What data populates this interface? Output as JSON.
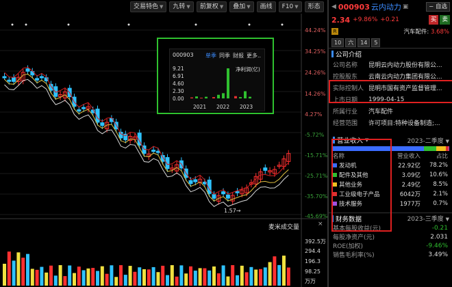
{
  "toolbar": {
    "items": [
      "交易特色",
      "九转",
      "前复权",
      "叠加",
      "画线",
      "F10",
      "形态"
    ]
  },
  "yaxis": {
    "price_labels": [
      "44.24%",
      "34.25%",
      "24.26%",
      "14.26%",
      "4.27%",
      "-5.72%",
      "-15.71%",
      "-25.71%",
      "-35.70%",
      "-45.69%"
    ],
    "volume_labels": [
      "392.5万",
      "294.4",
      "196.3",
      "98.25",
      "万万"
    ]
  },
  "chart": {
    "low_label": "1.57",
    "volume_title": "麦米成交量",
    "close_btn": "×"
  },
  "popup": {
    "code": "000903",
    "tabs": [
      "单季",
      "同季",
      "财报",
      "更多.."
    ],
    "title": "净利润(亿)",
    "yticks": [
      "9.21",
      "6.91",
      "4.60",
      "2.30",
      "0.00"
    ],
    "years": [
      "2021",
      "2022",
      "2023"
    ],
    "bars": [
      0.3,
      0.6,
      0.2,
      0.5,
      0.4,
      1.1,
      1.6,
      9.21,
      0.7,
      0.4,
      2.2,
      0.5
    ]
  },
  "header": {
    "code": "000903",
    "name": "云内动力",
    "add_label": "自选",
    "price": "2.34",
    "pct": "+9.86%",
    "change": "+0.21",
    "buy": "买",
    "sell": "卖",
    "badge": "R",
    "sector_label": "汽车配件:",
    "sector_pct": "3.68%",
    "num_tabs": [
      "10",
      "六",
      "14",
      "5"
    ]
  },
  "company": {
    "title": "公司介绍",
    "rows": [
      {
        "k": "公司名称",
        "v": "昆明云内动力股份有限公..."
      },
      {
        "k": "控股股东",
        "v": "云南云内动力集团有限公..."
      },
      {
        "k": "实际控制人",
        "v": "昆明市国有资产监督管理..."
      },
      {
        "k": "上市日期",
        "v": "1999-04-15"
      },
      {
        "k": "所属行业",
        "v": "汽车配件"
      },
      {
        "k": "经营范围",
        "v": "许可项目:特种设备制造;..."
      }
    ]
  },
  "revenue": {
    "title": "营业收入",
    "period": "2023-二季度",
    "columns": [
      "名称",
      "营业收入",
      "占比"
    ],
    "items": [
      {
        "name": "发动机",
        "value": "22.92亿",
        "pct": "78.2%",
        "color": "#3b6cff",
        "share": 78.2
      },
      {
        "name": "配件及其他",
        "value": "3.09亿",
        "pct": "10.6%",
        "color": "#2fbf2f",
        "share": 10.6
      },
      {
        "name": "其他业务",
        "value": "2.49亿",
        "pct": "8.5%",
        "color": "#f0c020",
        "share": 8.5
      },
      {
        "name": "工业级电子产品",
        "value": "6042万",
        "pct": "2.1%",
        "color": "#e03030",
        "share": 2.1
      },
      {
        "name": "技术服务",
        "value": "1977万",
        "pct": "0.7%",
        "color": "#a050e0",
        "share": 0.7
      }
    ]
  },
  "finance": {
    "title": "财务数据",
    "period": "2023-三季度",
    "rows": [
      {
        "k": "基本每股收益(元)",
        "v": "-0.21",
        "color": "#2fbf2f"
      },
      {
        "k": "每股净资产(元)",
        "v": "2.031",
        "color": "#dddddd"
      },
      {
        "k": "ROE(加权)",
        "v": "-9.46%",
        "color": "#2fbf2f"
      },
      {
        "k": "销售毛利率(%)",
        "v": "3.49%",
        "color": "#dddddd"
      }
    ]
  }
}
